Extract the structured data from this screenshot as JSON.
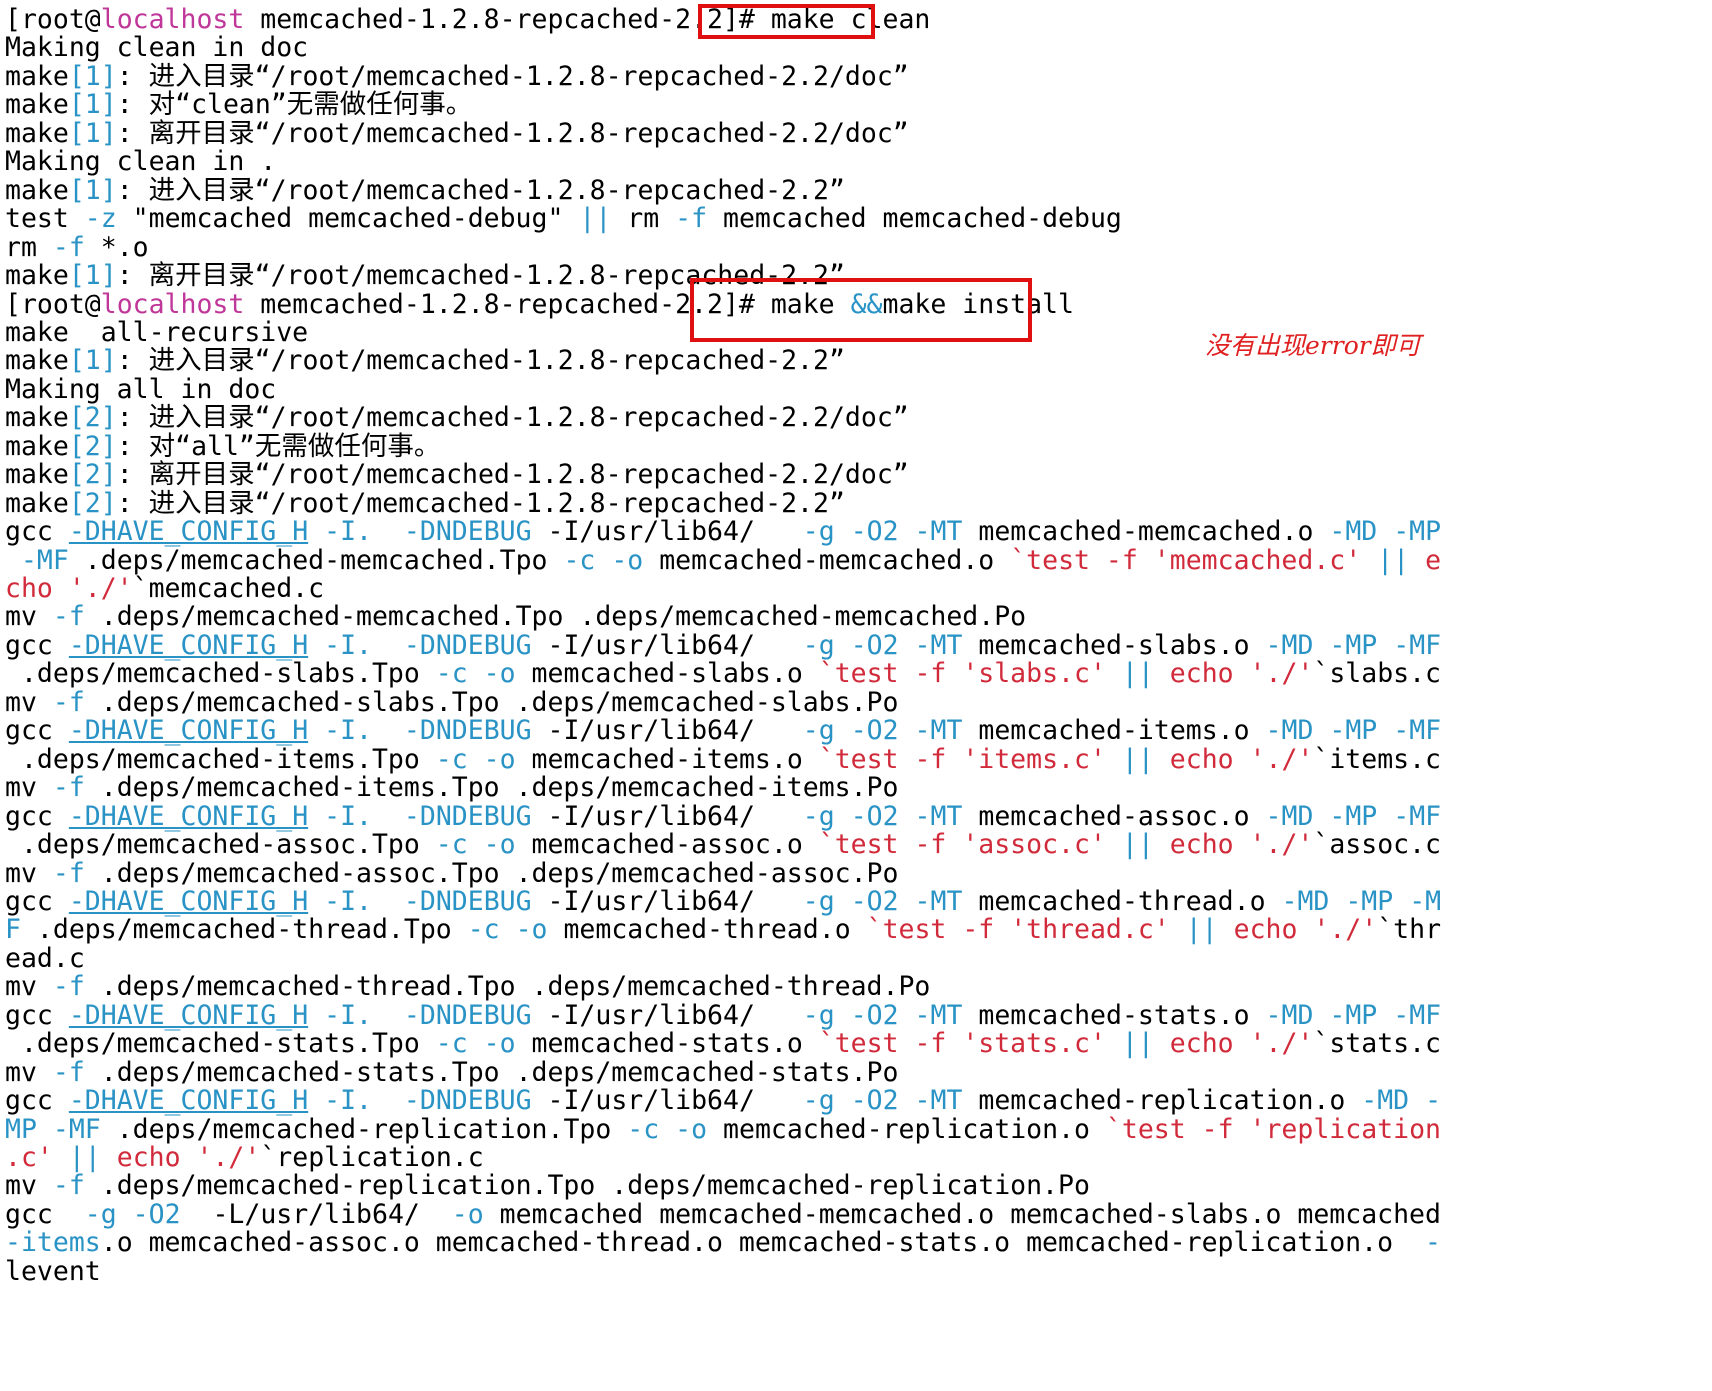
{
  "terminal": {
    "lines": [
      [
        [
          "[root@",
          ""
        ],
        [
          "localhost",
          "host"
        ],
        [
          " memcached-1.2.8-repcached-2.2]# make clean",
          ""
        ]
      ],
      [
        [
          "Making clean in doc",
          ""
        ]
      ],
      [
        [
          "make",
          ""
        ],
        [
          "[1]",
          "cyan"
        ],
        [
          ": 进入目录“/root/memcached-1.2.8-repcached-2.2/doc”",
          ""
        ]
      ],
      [
        [
          "make",
          ""
        ],
        [
          "[1]",
          "cyan"
        ],
        [
          ": 对“clean”无需做任何事。",
          ""
        ]
      ],
      [
        [
          "make",
          ""
        ],
        [
          "[1]",
          "cyan"
        ],
        [
          ": 离开目录“/root/memcached-1.2.8-repcached-2.2/doc”",
          ""
        ]
      ],
      [
        [
          "Making clean in .",
          ""
        ]
      ],
      [
        [
          "make",
          ""
        ],
        [
          "[1]",
          "cyan"
        ],
        [
          ": 进入目录“/root/memcached-1.2.8-repcached-2.2”",
          ""
        ]
      ],
      [
        [
          "test ",
          ""
        ],
        [
          "-z",
          "cyan"
        ],
        [
          " \"memcached memcached-debug\" ",
          ""
        ],
        [
          "||",
          "cyan"
        ],
        [
          " rm ",
          ""
        ],
        [
          "-f",
          "cyan"
        ],
        [
          " memcached memcached-debug",
          ""
        ]
      ],
      [
        [
          "rm ",
          ""
        ],
        [
          "-f",
          "cyan"
        ],
        [
          " *.o",
          ""
        ]
      ],
      [
        [
          "make",
          ""
        ],
        [
          "[1]",
          "cyan"
        ],
        [
          ": 离开目录“/root/memcached-1.2.8-repcached-2.2”",
          ""
        ]
      ],
      [
        [
          "[root@",
          ""
        ],
        [
          "localhost",
          "host"
        ],
        [
          " memcached-1.2.8-repcached-2.2]# make ",
          ""
        ],
        [
          "&&",
          "cyan"
        ],
        [
          "make install",
          ""
        ]
      ],
      [
        [
          "make  all-recursive",
          ""
        ]
      ],
      [
        [
          "make",
          ""
        ],
        [
          "[1]",
          "cyan"
        ],
        [
          ": 进入目录“/root/memcached-1.2.8-repcached-2.2”",
          ""
        ]
      ],
      [
        [
          "Making all in doc",
          ""
        ]
      ],
      [
        [
          "make",
          ""
        ],
        [
          "[2]",
          "cyan"
        ],
        [
          ": 进入目录“/root/memcached-1.2.8-repcached-2.2/doc”",
          ""
        ]
      ],
      [
        [
          "make",
          ""
        ],
        [
          "[2]",
          "cyan"
        ],
        [
          ": 对“all”无需做任何事。",
          ""
        ]
      ],
      [
        [
          "make",
          ""
        ],
        [
          "[2]",
          "cyan"
        ],
        [
          ": 离开目录“/root/memcached-1.2.8-repcached-2.2/doc”",
          ""
        ]
      ],
      [
        [
          "make",
          ""
        ],
        [
          "[2]",
          "cyan"
        ],
        [
          ": 进入目录“/root/memcached-1.2.8-repcached-2.2”",
          ""
        ]
      ],
      [
        [
          "gcc ",
          ""
        ],
        [
          "-DHAVE_CONFIG_H",
          "ul"
        ],
        [
          " ",
          ""
        ],
        [
          "-I.",
          "cyan"
        ],
        [
          "  ",
          ""
        ],
        [
          "-DNDEBUG",
          "cyan"
        ],
        [
          " -I/usr/lib64/   ",
          ""
        ],
        [
          "-g",
          "cyan"
        ],
        [
          " ",
          ""
        ],
        [
          "-O2",
          "cyan"
        ],
        [
          " ",
          ""
        ],
        [
          "-MT",
          "cyan"
        ],
        [
          " memcached-memcached.o ",
          ""
        ],
        [
          "-MD",
          "cyan"
        ],
        [
          " ",
          ""
        ],
        [
          "-MP",
          "cyan"
        ]
      ],
      [
        [
          " ",
          ""
        ],
        [
          "-MF",
          "cyan"
        ],
        [
          " .deps/memcached-memcached.Tpo ",
          ""
        ],
        [
          "-c",
          "cyan"
        ],
        [
          " ",
          ""
        ],
        [
          "-o",
          "cyan"
        ],
        [
          " memcached-memcached.o ",
          ""
        ],
        [
          "`test -f 'memcached.c'",
          "red"
        ],
        [
          " ",
          ""
        ],
        [
          "||",
          "cyan"
        ],
        [
          " ",
          ""
        ],
        [
          "e",
          "red"
        ]
      ],
      [
        [
          "cho './'",
          "red"
        ],
        [
          "`memcached.c",
          ""
        ]
      ],
      [
        [
          "mv ",
          ""
        ],
        [
          "-f",
          "cyan"
        ],
        [
          " .deps/memcached-memcached.Tpo .deps/memcached-memcached.Po",
          ""
        ]
      ],
      [
        [
          "gcc ",
          ""
        ],
        [
          "-DHAVE_CONFIG_H",
          "ul"
        ],
        [
          " ",
          ""
        ],
        [
          "-I.",
          "cyan"
        ],
        [
          "  ",
          ""
        ],
        [
          "-DNDEBUG",
          "cyan"
        ],
        [
          " -I/usr/lib64/   ",
          ""
        ],
        [
          "-g",
          "cyan"
        ],
        [
          " ",
          ""
        ],
        [
          "-O2",
          "cyan"
        ],
        [
          " ",
          ""
        ],
        [
          "-MT",
          "cyan"
        ],
        [
          " memcached-slabs.o ",
          ""
        ],
        [
          "-MD",
          "cyan"
        ],
        [
          " ",
          ""
        ],
        [
          "-MP",
          "cyan"
        ],
        [
          " ",
          ""
        ],
        [
          "-MF",
          "cyan"
        ]
      ],
      [
        [
          " .deps/memcached-slabs.Tpo ",
          ""
        ],
        [
          "-c",
          "cyan"
        ],
        [
          " ",
          ""
        ],
        [
          "-o",
          "cyan"
        ],
        [
          " memcached-slabs.o ",
          ""
        ],
        [
          "`test -f 'slabs.c'",
          "red"
        ],
        [
          " ",
          ""
        ],
        [
          "||",
          "cyan"
        ],
        [
          " ",
          ""
        ],
        [
          "echo './'",
          "red"
        ],
        [
          "`slabs.c",
          ""
        ]
      ],
      [
        [
          "mv ",
          ""
        ],
        [
          "-f",
          "cyan"
        ],
        [
          " .deps/memcached-slabs.Tpo .deps/memcached-slabs.Po",
          ""
        ]
      ],
      [
        [
          "gcc ",
          ""
        ],
        [
          "-DHAVE_CONFIG_H",
          "ul"
        ],
        [
          " ",
          ""
        ],
        [
          "-I.",
          "cyan"
        ],
        [
          "  ",
          ""
        ],
        [
          "-DNDEBUG",
          "cyan"
        ],
        [
          " -I/usr/lib64/   ",
          ""
        ],
        [
          "-g",
          "cyan"
        ],
        [
          " ",
          ""
        ],
        [
          "-O2",
          "cyan"
        ],
        [
          " ",
          ""
        ],
        [
          "-MT",
          "cyan"
        ],
        [
          " memcached-items.o ",
          ""
        ],
        [
          "-MD",
          "cyan"
        ],
        [
          " ",
          ""
        ],
        [
          "-MP",
          "cyan"
        ],
        [
          " ",
          ""
        ],
        [
          "-MF",
          "cyan"
        ]
      ],
      [
        [
          " .deps/memcached-items.Tpo ",
          ""
        ],
        [
          "-c",
          "cyan"
        ],
        [
          " ",
          ""
        ],
        [
          "-o",
          "cyan"
        ],
        [
          " memcached-items.o ",
          ""
        ],
        [
          "`test -f 'items.c'",
          "red"
        ],
        [
          " ",
          ""
        ],
        [
          "||",
          "cyan"
        ],
        [
          " ",
          ""
        ],
        [
          "echo './'",
          "red"
        ],
        [
          "`items.c",
          ""
        ]
      ],
      [
        [
          "mv ",
          ""
        ],
        [
          "-f",
          "cyan"
        ],
        [
          " .deps/memcached-items.Tpo .deps/memcached-items.Po",
          ""
        ]
      ],
      [
        [
          "gcc ",
          ""
        ],
        [
          "-DHAVE_CONFIG_H",
          "ul"
        ],
        [
          " ",
          ""
        ],
        [
          "-I.",
          "cyan"
        ],
        [
          "  ",
          ""
        ],
        [
          "-DNDEBUG",
          "cyan"
        ],
        [
          " -I/usr/lib64/   ",
          ""
        ],
        [
          "-g",
          "cyan"
        ],
        [
          " ",
          ""
        ],
        [
          "-O2",
          "cyan"
        ],
        [
          " ",
          ""
        ],
        [
          "-MT",
          "cyan"
        ],
        [
          " memcached-assoc.o ",
          ""
        ],
        [
          "-MD",
          "cyan"
        ],
        [
          " ",
          ""
        ],
        [
          "-MP",
          "cyan"
        ],
        [
          " ",
          ""
        ],
        [
          "-MF",
          "cyan"
        ]
      ],
      [
        [
          " .deps/memcached-assoc.Tpo ",
          ""
        ],
        [
          "-c",
          "cyan"
        ],
        [
          " ",
          ""
        ],
        [
          "-o",
          "cyan"
        ],
        [
          " memcached-assoc.o ",
          ""
        ],
        [
          "`test -f 'assoc.c'",
          "red"
        ],
        [
          " ",
          ""
        ],
        [
          "||",
          "cyan"
        ],
        [
          " ",
          ""
        ],
        [
          "echo './'",
          "red"
        ],
        [
          "`assoc.c",
          ""
        ]
      ],
      [
        [
          "mv ",
          ""
        ],
        [
          "-f",
          "cyan"
        ],
        [
          " .deps/memcached-assoc.Tpo .deps/memcached-assoc.Po",
          ""
        ]
      ],
      [
        [
          "gcc ",
          ""
        ],
        [
          "-DHAVE_CONFIG_H",
          "ul"
        ],
        [
          " ",
          ""
        ],
        [
          "-I.",
          "cyan"
        ],
        [
          "  ",
          ""
        ],
        [
          "-DNDEBUG",
          "cyan"
        ],
        [
          " -I/usr/lib64/   ",
          ""
        ],
        [
          "-g",
          "cyan"
        ],
        [
          " ",
          ""
        ],
        [
          "-O2",
          "cyan"
        ],
        [
          " ",
          ""
        ],
        [
          "-MT",
          "cyan"
        ],
        [
          " memcached-thread.o ",
          ""
        ],
        [
          "-MD",
          "cyan"
        ],
        [
          " ",
          ""
        ],
        [
          "-MP",
          "cyan"
        ],
        [
          " ",
          ""
        ],
        [
          "-M",
          "cyan"
        ]
      ],
      [
        [
          "F",
          "cyan"
        ],
        [
          " .deps/memcached-thread.Tpo ",
          ""
        ],
        [
          "-c",
          "cyan"
        ],
        [
          " ",
          ""
        ],
        [
          "-o",
          "cyan"
        ],
        [
          " memcached-thread.o ",
          ""
        ],
        [
          "`test -f 'thread.c'",
          "red"
        ],
        [
          " ",
          ""
        ],
        [
          "||",
          "cyan"
        ],
        [
          " ",
          ""
        ],
        [
          "echo './'",
          "red"
        ],
        [
          "`thr",
          ""
        ]
      ],
      [
        [
          "ead.c",
          ""
        ]
      ],
      [
        [
          "mv ",
          ""
        ],
        [
          "-f",
          "cyan"
        ],
        [
          " .deps/memcached-thread.Tpo .deps/memcached-thread.Po",
          ""
        ]
      ],
      [
        [
          "gcc ",
          ""
        ],
        [
          "-DHAVE_CONFIG_H",
          "ul"
        ],
        [
          " ",
          ""
        ],
        [
          "-I.",
          "cyan"
        ],
        [
          "  ",
          ""
        ],
        [
          "-DNDEBUG",
          "cyan"
        ],
        [
          " -I/usr/lib64/   ",
          ""
        ],
        [
          "-g",
          "cyan"
        ],
        [
          " ",
          ""
        ],
        [
          "-O2",
          "cyan"
        ],
        [
          " ",
          ""
        ],
        [
          "-MT",
          "cyan"
        ],
        [
          " memcached-stats.o ",
          ""
        ],
        [
          "-MD",
          "cyan"
        ],
        [
          " ",
          ""
        ],
        [
          "-MP",
          "cyan"
        ],
        [
          " ",
          ""
        ],
        [
          "-MF",
          "cyan"
        ]
      ],
      [
        [
          " .deps/memcached-stats.Tpo ",
          ""
        ],
        [
          "-c",
          "cyan"
        ],
        [
          " ",
          ""
        ],
        [
          "-o",
          "cyan"
        ],
        [
          " memcached-stats.o ",
          ""
        ],
        [
          "`test -f 'stats.c'",
          "red"
        ],
        [
          " ",
          ""
        ],
        [
          "||",
          "cyan"
        ],
        [
          " ",
          ""
        ],
        [
          "echo './'",
          "red"
        ],
        [
          "`stats.c",
          ""
        ]
      ],
      [
        [
          "mv ",
          ""
        ],
        [
          "-f",
          "cyan"
        ],
        [
          " .deps/memcached-stats.Tpo .deps/memcached-stats.Po",
          ""
        ]
      ],
      [
        [
          "gcc ",
          ""
        ],
        [
          "-DHAVE_CONFIG_H",
          "ul"
        ],
        [
          " ",
          ""
        ],
        [
          "-I.",
          "cyan"
        ],
        [
          "  ",
          ""
        ],
        [
          "-DNDEBUG",
          "cyan"
        ],
        [
          " -I/usr/lib64/   ",
          ""
        ],
        [
          "-g",
          "cyan"
        ],
        [
          " ",
          ""
        ],
        [
          "-O2",
          "cyan"
        ],
        [
          " ",
          ""
        ],
        [
          "-MT",
          "cyan"
        ],
        [
          " memcached-replication.o ",
          ""
        ],
        [
          "-MD",
          "cyan"
        ],
        [
          " ",
          ""
        ],
        [
          "-",
          "cyan"
        ]
      ],
      [
        [
          "MP",
          "cyan"
        ],
        [
          " ",
          ""
        ],
        [
          "-MF",
          "cyan"
        ],
        [
          " .deps/memcached-replication.Tpo ",
          ""
        ],
        [
          "-c",
          "cyan"
        ],
        [
          " ",
          ""
        ],
        [
          "-o",
          "cyan"
        ],
        [
          " memcached-replication.o ",
          ""
        ],
        [
          "`test -f 'replication",
          "red"
        ]
      ],
      [
        [
          ".c'",
          "red"
        ],
        [
          " ",
          ""
        ],
        [
          "||",
          "cyan"
        ],
        [
          " ",
          ""
        ],
        [
          "echo './'",
          "red"
        ],
        [
          "`replication.c",
          ""
        ]
      ],
      [
        [
          "mv ",
          ""
        ],
        [
          "-f",
          "cyan"
        ],
        [
          " .deps/memcached-replication.Tpo .deps/memcached-replication.Po",
          ""
        ]
      ],
      [
        [
          "gcc  ",
          ""
        ],
        [
          "-g",
          "cyan"
        ],
        [
          " ",
          ""
        ],
        [
          "-O2",
          "cyan"
        ],
        [
          "  -L/usr/lib64/  ",
          ""
        ],
        [
          "-o",
          "cyan"
        ],
        [
          " memcached memcached-memcached.o memcached-slabs.o memcached",
          ""
        ]
      ],
      [
        [
          "-items",
          "cyan"
        ],
        [
          ".o memcached-assoc.o memcached-thread.o memcached-stats.o memcached-replication.o  ",
          ""
        ],
        [
          "-",
          "cyan"
        ]
      ],
      [
        [
          "levent",
          ""
        ]
      ]
    ]
  },
  "annotation": {
    "text": "没有出现error即可"
  },
  "colors": {
    "hostname": "#c0379a",
    "option": "#2a93c5",
    "quoted": "#d12b3b",
    "highlight_box": "#e01010"
  }
}
